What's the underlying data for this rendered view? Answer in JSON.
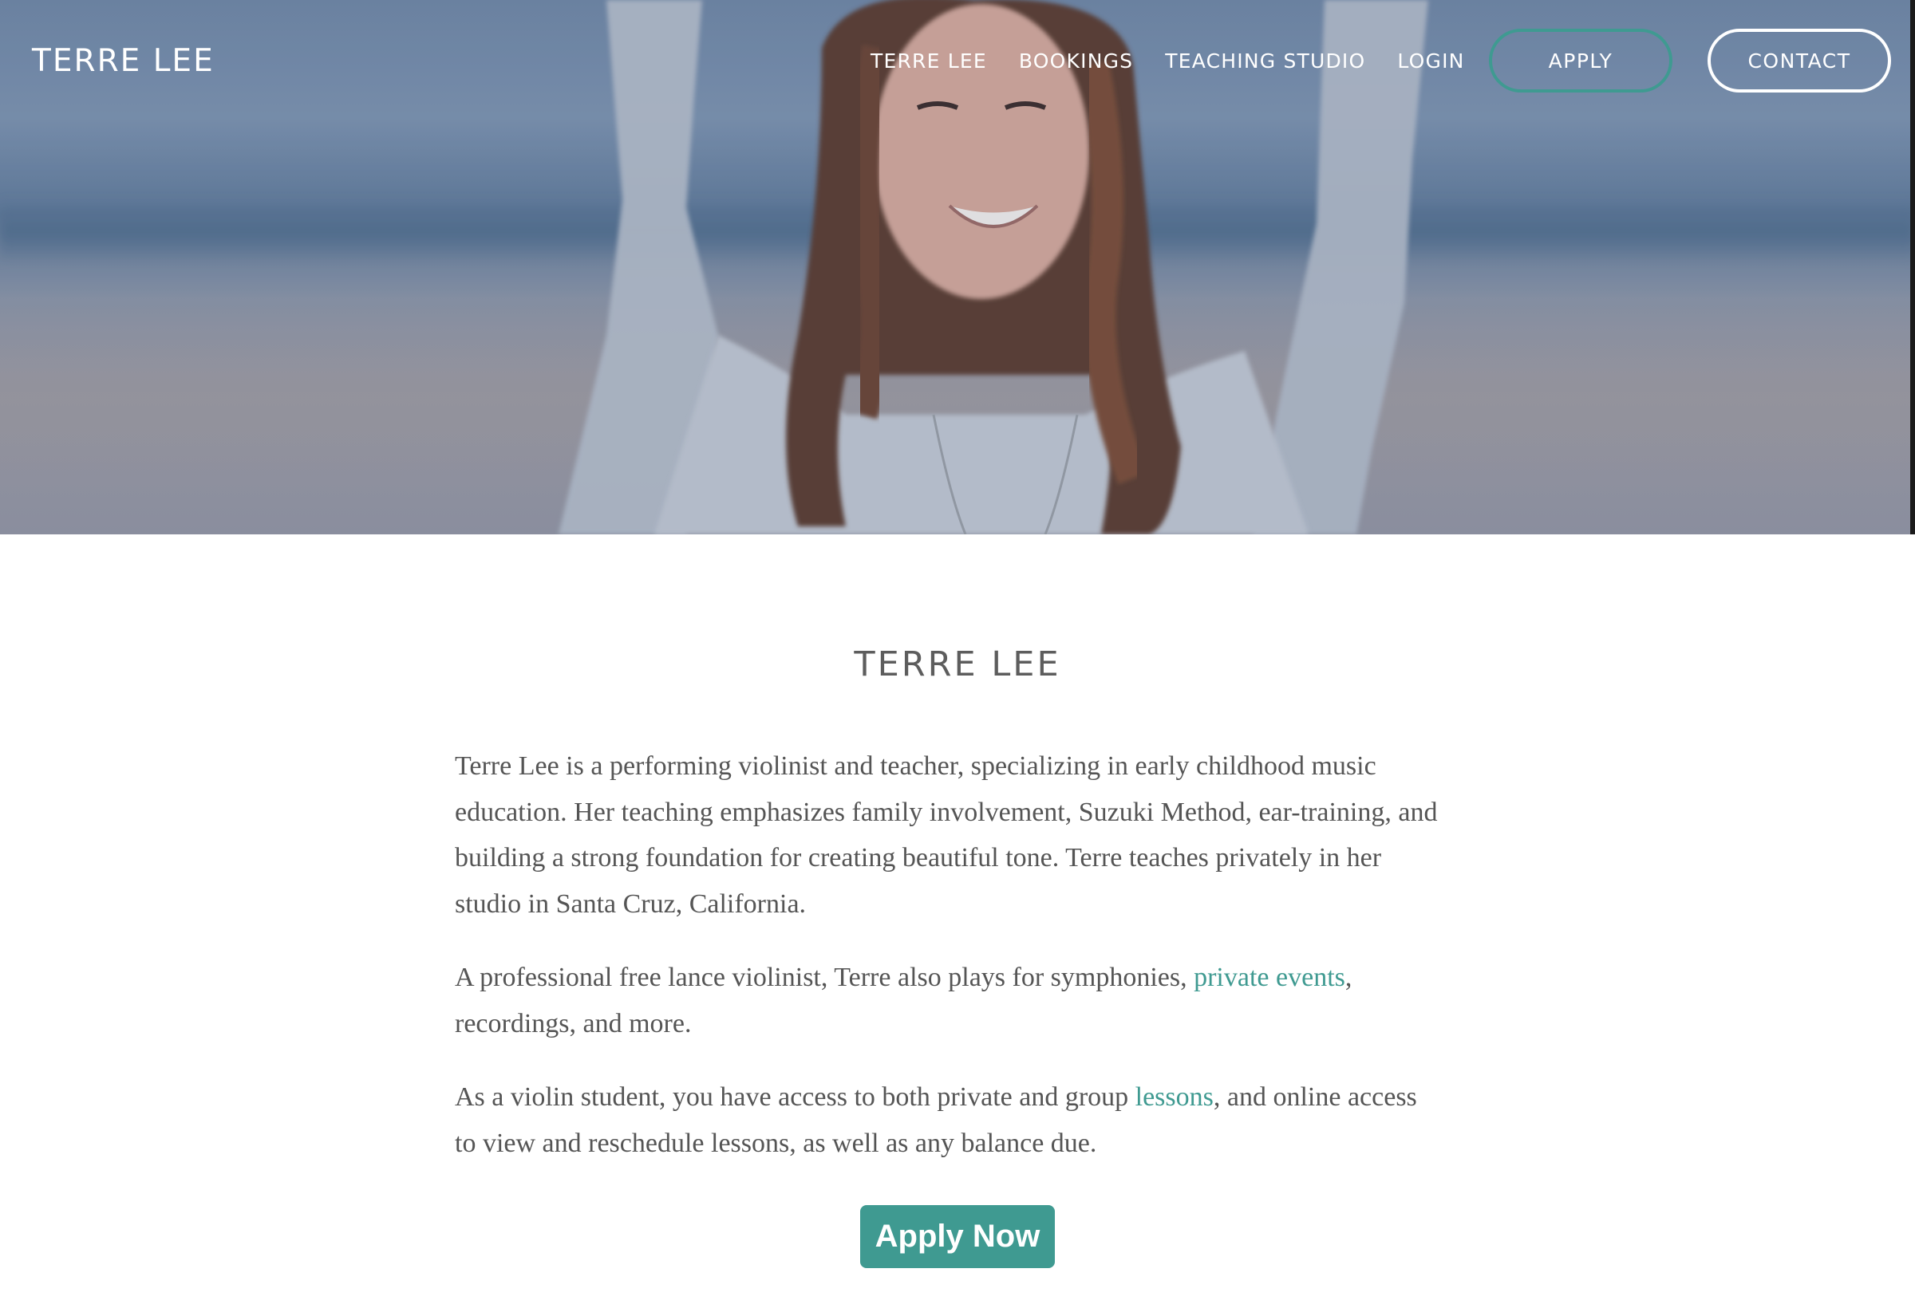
{
  "header": {
    "logo": "TERRE LEE",
    "nav": [
      {
        "label": "TERRE LEE"
      },
      {
        "label": "BOOKINGS"
      },
      {
        "label": "TEACHING STUDIO"
      },
      {
        "label": "LOGIN"
      }
    ],
    "apply_label": "APPLY",
    "contact_label": "CONTACT"
  },
  "hero": {
    "image_description": "Smiling woman with long brown hair raising her arms on a beach"
  },
  "main": {
    "title": "TERRE LEE",
    "paragraphs": {
      "p1": "Terre Lee is a performing violinist and teacher, specializing in early childhood music education. Her teaching emphasizes family involvement, Suzuki Method, ear-training, and building a strong foundation for creating beautiful tone. Terre teaches privately in her studio in Santa Cruz, California.",
      "p2_before": "A professional free lance violinist, Terre also plays for symphonies, ",
      "p2_link": "private events",
      "p2_after": ", recordings, and more.",
      "p3_before": "As a violin student, you have access to both private and group ",
      "p3_link": "lessons",
      "p3_after": ", and online access to view and reschedule lessons, as well as any balance due."
    },
    "cta_label": "Apply Now"
  },
  "colors": {
    "accent": "#3f9a91",
    "text": "#555555",
    "heading": "#5d5d5d"
  }
}
